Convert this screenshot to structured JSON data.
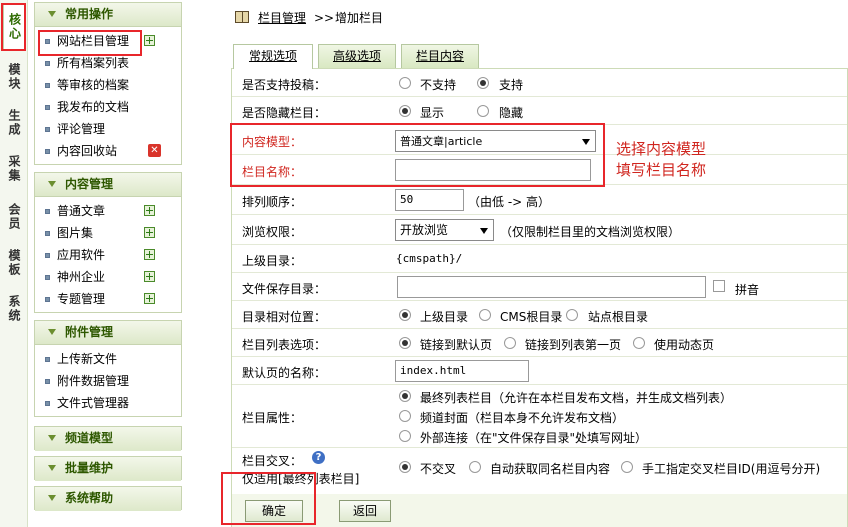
{
  "vtabs": [
    {
      "label": "核心",
      "active": true
    },
    {
      "label": "模块"
    },
    {
      "label": "生成"
    },
    {
      "label": "采集"
    },
    {
      "label": "会员"
    },
    {
      "label": "模板"
    },
    {
      "label": "系统"
    }
  ],
  "sidebar": {
    "common": {
      "title": "常用操作",
      "items": [
        "网站栏目管理",
        "所有档案列表",
        "等审核的档案",
        "我发布的文档",
        "评论管理",
        "内容回收站"
      ]
    },
    "content": {
      "title": "内容管理",
      "items": [
        "普通文章",
        "图片集",
        "应用软件",
        "神州企业",
        "专题管理"
      ]
    },
    "attach": {
      "title": "附件管理",
      "items": [
        "上传新文件",
        "附件数据管理",
        "文件式管理器"
      ]
    },
    "collapsed": [
      "频道模型",
      "批量维护",
      "系统帮助"
    ]
  },
  "crumb": {
    "link": "栏目管理",
    "sep": ">>",
    "current": "增加栏目"
  },
  "tabs": [
    "常规选项",
    "高级选项",
    "栏目内容"
  ],
  "form": {
    "contribute": {
      "label": "是否支持投稿：",
      "opt1": "不支持",
      "opt2": "支持"
    },
    "hidden": {
      "label": "是否隐藏栏目：",
      "opt1": "显示",
      "opt2": "隐藏"
    },
    "model": {
      "label": "内容模型：",
      "value": "普通文章|article"
    },
    "name": {
      "label": "栏目名称：",
      "value": ""
    },
    "order": {
      "label": "排列顺序：",
      "value": "50",
      "note": "（由低 -> 高）"
    },
    "access": {
      "label": "浏览权限：",
      "value": "开放浏览",
      "note": "（仅限制栏目里的文档浏览权限）"
    },
    "parent": {
      "label": "上级目录：",
      "value": "{cmspath}/"
    },
    "savedir": {
      "label": "文件保存目录：",
      "value": "",
      "pinyin": "拼音"
    },
    "relpos": {
      "label": "目录相对位置：",
      "opt1": "上级目录",
      "opt2": "CMS根目录",
      "opt3": "站点根目录"
    },
    "listopt": {
      "label": "栏目列表选项：",
      "opt1": "链接到默认页",
      "opt2": "链接到列表第一页",
      "opt3": "使用动态页"
    },
    "defpage": {
      "label": "默认页的名称：",
      "value": "index.html"
    },
    "attr": {
      "label": "栏目属性：",
      "opt1": "最终列表栏目（允许在本栏目发布文档，并生成文档列表）",
      "opt2": "频道封面（栏目本身不允许发布文档）",
      "opt3": "外部连接（在\"文件保存目录\"处填写网址）"
    },
    "cross": {
      "label": "栏目交叉：",
      "sublabel": "仅适用[最终列表栏目]",
      "opt1": "不交叉",
      "opt2": "自动获取同名栏目内容",
      "opt3": "手工指定交叉栏目ID(用逗号分开)"
    }
  },
  "buttons": {
    "ok": "确定",
    "back": "返回"
  },
  "annotations": {
    "line1": "选择内容模型",
    "line2": "填写栏目名称"
  },
  "colors": {
    "accent": "#e8262b",
    "header_green": "#2e5800"
  }
}
